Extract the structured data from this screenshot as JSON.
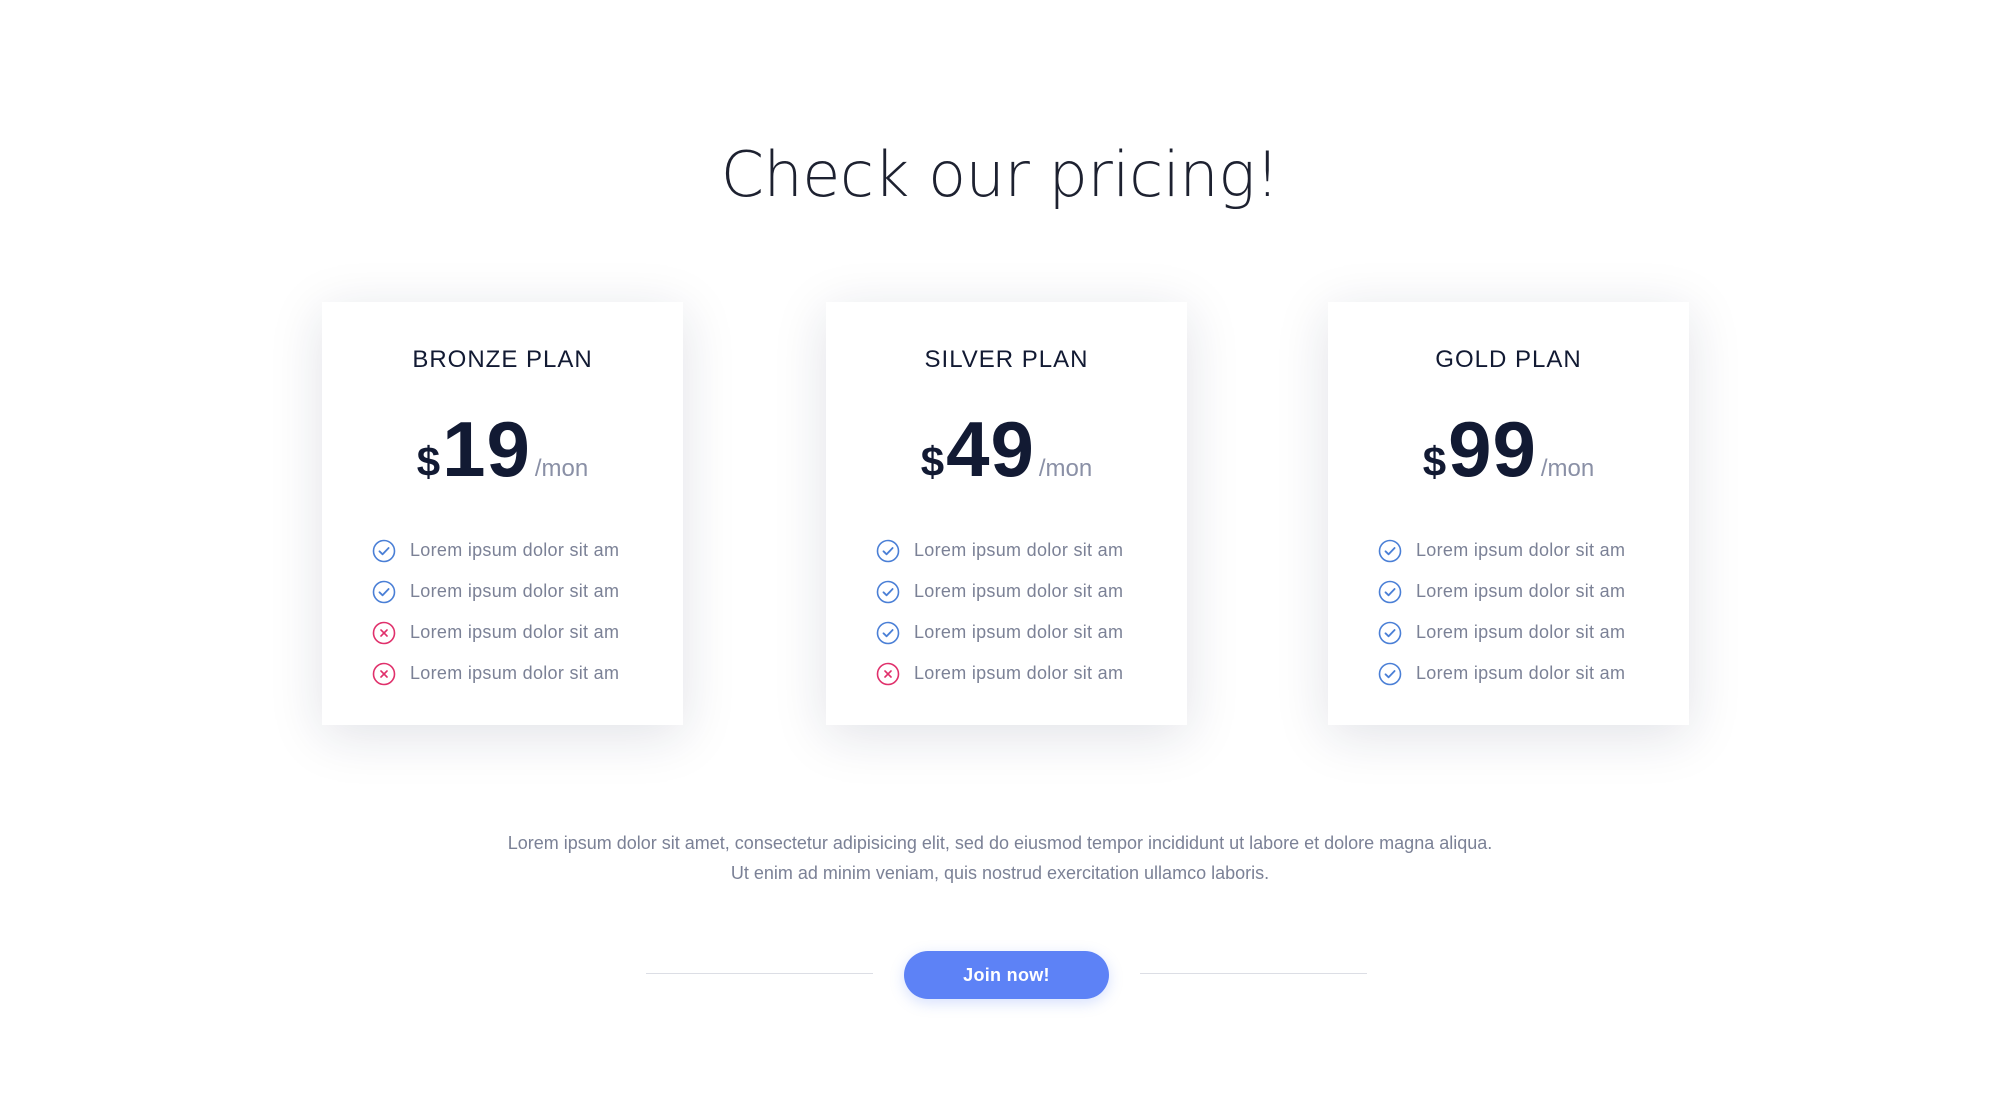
{
  "heading": "Check our pricing!",
  "plans": [
    {
      "name": "BRONZE PLAN",
      "currency": "$",
      "amount": "19",
      "period": "/mon",
      "features": [
        {
          "text": "Lorem ipsum dolor sit am",
          "included": true
        },
        {
          "text": "Lorem ipsum dolor sit am",
          "included": true
        },
        {
          "text": "Lorem ipsum dolor sit am",
          "included": false
        },
        {
          "text": "Lorem ipsum dolor sit am",
          "included": false
        }
      ]
    },
    {
      "name": "SILVER PLAN",
      "currency": "$",
      "amount": "49",
      "period": "/mon",
      "features": [
        {
          "text": "Lorem ipsum dolor sit am",
          "included": true
        },
        {
          "text": "Lorem ipsum dolor sit am",
          "included": true
        },
        {
          "text": "Lorem ipsum dolor sit am",
          "included": true
        },
        {
          "text": "Lorem ipsum dolor sit am",
          "included": false
        }
      ]
    },
    {
      "name": "GOLD PLAN",
      "currency": "$",
      "amount": "99",
      "period": "/mon",
      "features": [
        {
          "text": "Lorem ipsum dolor sit am",
          "included": true
        },
        {
          "text": "Lorem ipsum dolor sit am",
          "included": true
        },
        {
          "text": "Lorem ipsum dolor sit am",
          "included": true
        },
        {
          "text": "Lorem ipsum dolor sit am",
          "included": true
        }
      ]
    }
  ],
  "description": "Lorem ipsum dolor sit amet, consectetur adipisicing elit, sed do eiusmod tempor incididunt ut labore et dolore magna aliqua. Ut enim ad minim veniam, quis nostrud exercitation ullamco laboris.",
  "cta": {
    "label": "Join now!"
  },
  "icons": {
    "included": "check-circle-icon",
    "excluded": "x-circle-icon"
  },
  "colors": {
    "background": "#ffffff",
    "heading": "#1d2130",
    "price": "#121a33",
    "muted_text": "#7b8196",
    "check_icon": "#4a7fd6",
    "cross_icon": "#e0306b",
    "button": "#5d82f6",
    "divider": "#dcdee5"
  }
}
